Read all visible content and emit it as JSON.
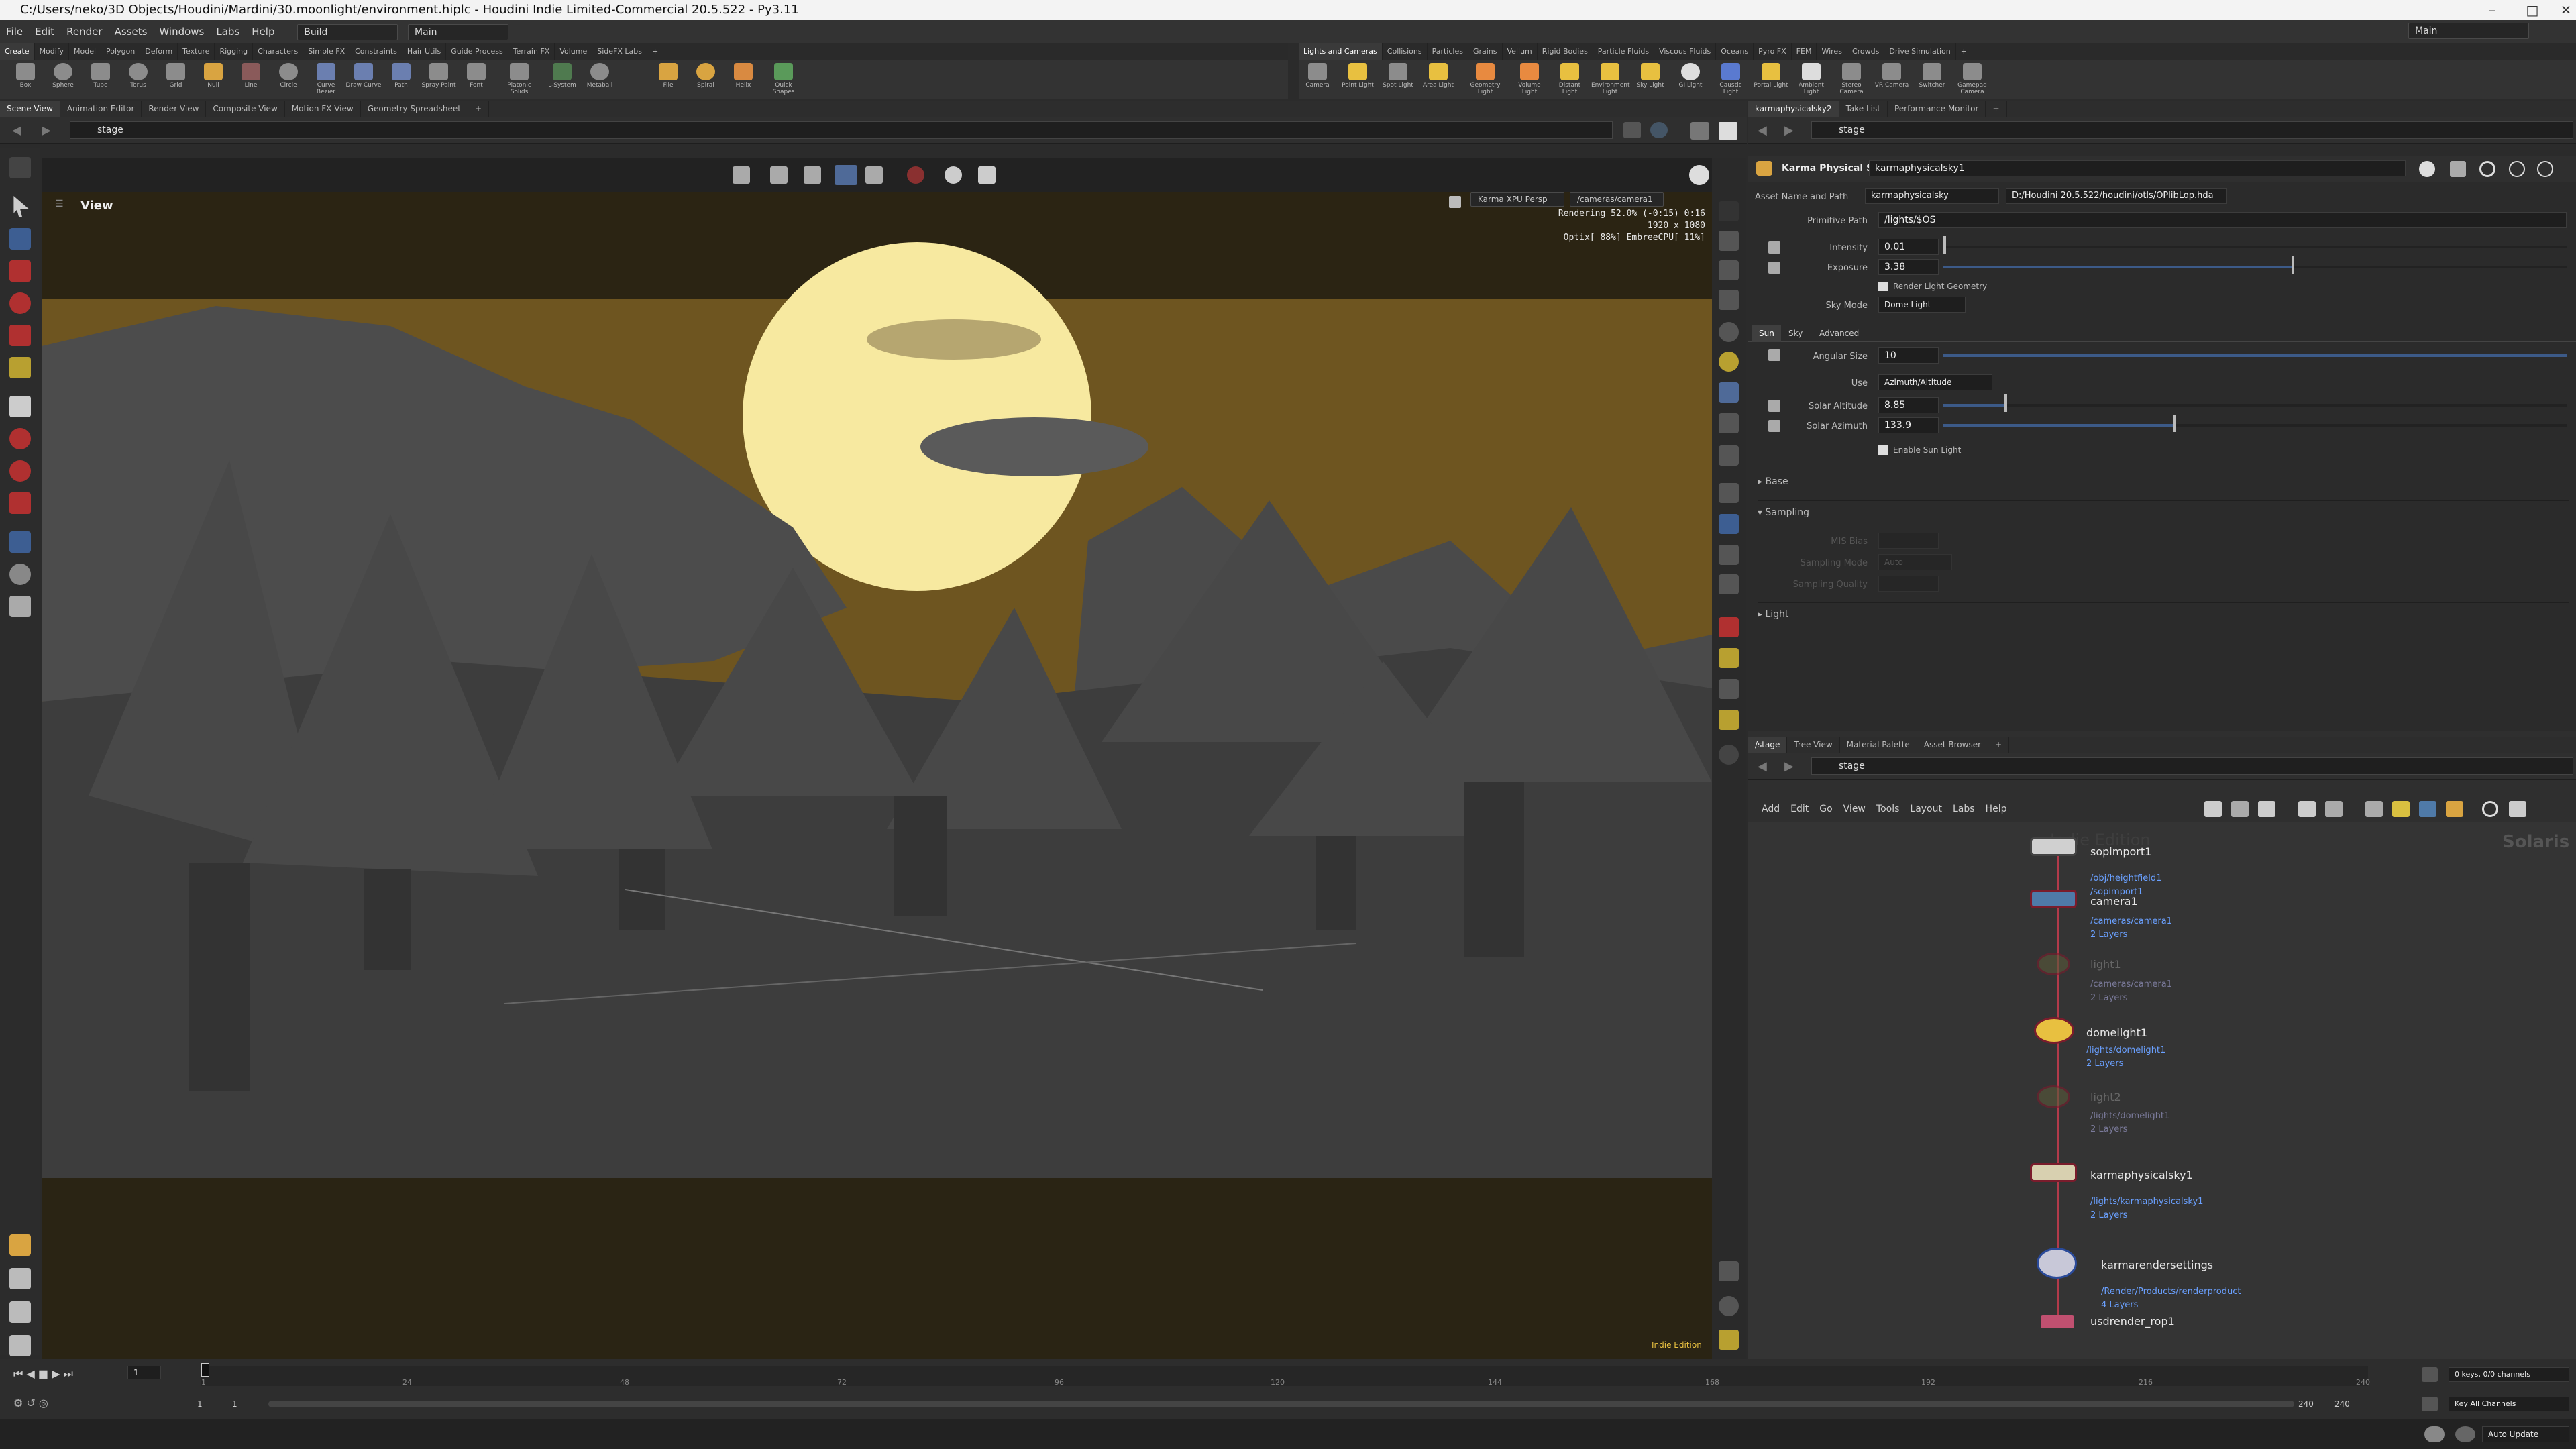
{
  "window": {
    "title": "C:/Users/neko/3D Objects/Houdini/Mardini/30.moonlight/environment.hiplc - Houdini Indie Limited-Commercial 20.5.522 - Py3.11"
  },
  "menu": {
    "items": [
      "File",
      "Edit",
      "Render",
      "Assets",
      "Windows",
      "Labs",
      "Help"
    ],
    "build": "Build",
    "desktop": "Main",
    "desktop_right": "Main"
  },
  "shelf_left": {
    "tabs": [
      "Create",
      "Modify",
      "Model",
      "Polygon",
      "Deform",
      "Texture",
      "Rigging",
      "Characters",
      "Simple FX",
      "Constraints",
      "Hair Utils",
      "Guide Process",
      "Terrain FX",
      "Volume",
      "SideFX Labs"
    ],
    "tools": [
      "Box",
      "Sphere",
      "Tube",
      "Torus",
      "Grid",
      "Null",
      "Line",
      "Circle",
      "Curve Bezier",
      "Draw Curve",
      "Path",
      "Spray Paint",
      "Font",
      "Platonic Solids",
      "L-System",
      "Metaball",
      "File",
      "Spiral",
      "Helix",
      "Quick Shapes"
    ]
  },
  "shelf_right": {
    "tabs": [
      "Lights and Cameras",
      "Collisions",
      "Particles",
      "Grains",
      "Vellum",
      "Rigid Bodies",
      "Particle Fluids",
      "Viscous Fluids",
      "Oceans",
      "Pyro FX",
      "FEM",
      "Wires",
      "Crowds",
      "Drive Simulation"
    ],
    "tools": [
      "Camera",
      "Point Light",
      "Spot Light",
      "Area Light",
      "Geometry Light",
      "Volume Light",
      "Distant Light",
      "Environment Light",
      "Sky Light",
      "GI Light",
      "Caustic Light",
      "Portal Light",
      "Ambient Light",
      "Stereo Camera",
      "VR Camera",
      "Switcher",
      "Gamepad Camera"
    ]
  },
  "viewer": {
    "tabs": [
      "Scene View",
      "Animation Editor",
      "Render View",
      "Composite View",
      "Motion FX View",
      "Geometry Spreadsheet"
    ],
    "path": "stage",
    "label": "View",
    "renderer": "Karma XPU Persp",
    "camera": "/cameras/camera1",
    "stats": [
      "Rendering   52.0%  (-0:15)  0:16",
      "1920 x 1080",
      "Optix[ 88%] EmbreeCPU[ 11%]"
    ],
    "edition": "Indie Edition",
    "colors": {
      "moon": "#f7e9a0",
      "sky": "#6e5520",
      "terrain": "#3d3d3d"
    }
  },
  "params": {
    "tabs": [
      "karmaphysicalsky2",
      "Take List",
      "Performance Monitor"
    ],
    "path": "stage",
    "node_type": "Karma Physical Sky",
    "node_name": "karmaphysicalsky1",
    "asset_label": "Asset Name and Path",
    "asset_name": "karmaphysicalsky",
    "asset_path": "D:/Houdini 20.5.522/houdini/otls/OPlibLop.hda",
    "primitive_path_label": "Primitive Path",
    "primitive_path": "/lights/$OS",
    "intensity_label": "Intensity",
    "intensity": "0.01",
    "exposure_label": "Exposure",
    "exposure": "3.38",
    "render_geo": "Render Light Geometry",
    "sky_mode_label": "Sky Mode",
    "sky_mode": "Dome Light",
    "subtabs": [
      "Sun",
      "Sky",
      "Advanced"
    ],
    "angular_label": "Angular Size",
    "angular": "10",
    "use_label": "Use",
    "use": "Azimuth/Altitude",
    "altitude_label": "Solar Altitude",
    "altitude": "8.85",
    "azimuth_label": "Solar Azimuth",
    "azimuth": "133.9",
    "enable_sun": "Enable Sun Light",
    "sections": [
      "Base",
      "Sampling",
      "Light"
    ],
    "mis_label": "MIS Bias",
    "mode_label": "Sampling Mode",
    "mode": "Auto",
    "quality_label": "Sampling Quality"
  },
  "network": {
    "tabs": [
      "/stage",
      "Tree View",
      "Material Palette",
      "Asset Browser"
    ],
    "path": "stage",
    "menu": [
      "Add",
      "Edit",
      "Go",
      "View",
      "Tools",
      "Layout",
      "Labs",
      "Help"
    ],
    "watermark": "Indie Edition",
    "context": "Solaris",
    "nodes": [
      {
        "name": "sopimport1",
        "sub1": "/obj/heightfield1",
        "sub2": "/sopimport1"
      },
      {
        "name": "camera1",
        "sub1": "/cameras/camera1",
        "sub2": "2 Layers"
      },
      {
        "name": "light1",
        "sub1": "/cameras/camera1",
        "sub2": "2 Layers"
      },
      {
        "name": "domelight1",
        "sub1": "/lights/domelight1",
        "sub2": "2 Layers"
      },
      {
        "name": "light2",
        "sub1": "/lights/domelight1",
        "sub2": "2 Layers"
      },
      {
        "name": "karmaphysicalsky1",
        "sub1": "/lights/karmaphysicalsky1",
        "sub2": "2 Layers"
      },
      {
        "name": "karmarendersettings",
        "sub1": "/Render/Products/renderproduct",
        "sub2": "4 Layers"
      },
      {
        "name": "usdrender_rop1",
        "sub1": "",
        "sub2": ""
      }
    ]
  },
  "timeline": {
    "ticks": [
      "1",
      "24",
      "48",
      "72",
      "96",
      "120",
      "144",
      "168",
      "192",
      "216",
      "240"
    ],
    "frame": "1",
    "start": "1",
    "start2": "1",
    "end": "240",
    "end2": "240",
    "keys": "0 keys, 0/0 channels",
    "key_all": "Key All Channels",
    "auto_update": "Auto Update"
  }
}
